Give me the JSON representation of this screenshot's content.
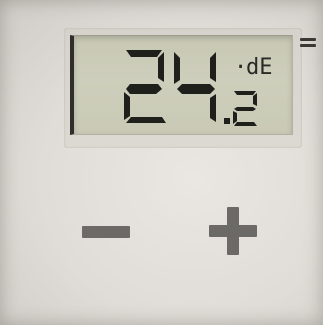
{
  "display": {
    "integer_digits": "24",
    "decimal_digit": "2",
    "reading": "24.2",
    "unit": "dE",
    "unit_prefix": "·"
  },
  "controls": {
    "minus_label": "−",
    "plus_label": "+"
  },
  "colors": {
    "lcd_background": "#cacbb7",
    "segment": "#1f1f1c",
    "button_symbol": "#6b6a67",
    "housing": "#e3e0dc"
  },
  "icons": {
    "status": "signal-bars-icon"
  }
}
